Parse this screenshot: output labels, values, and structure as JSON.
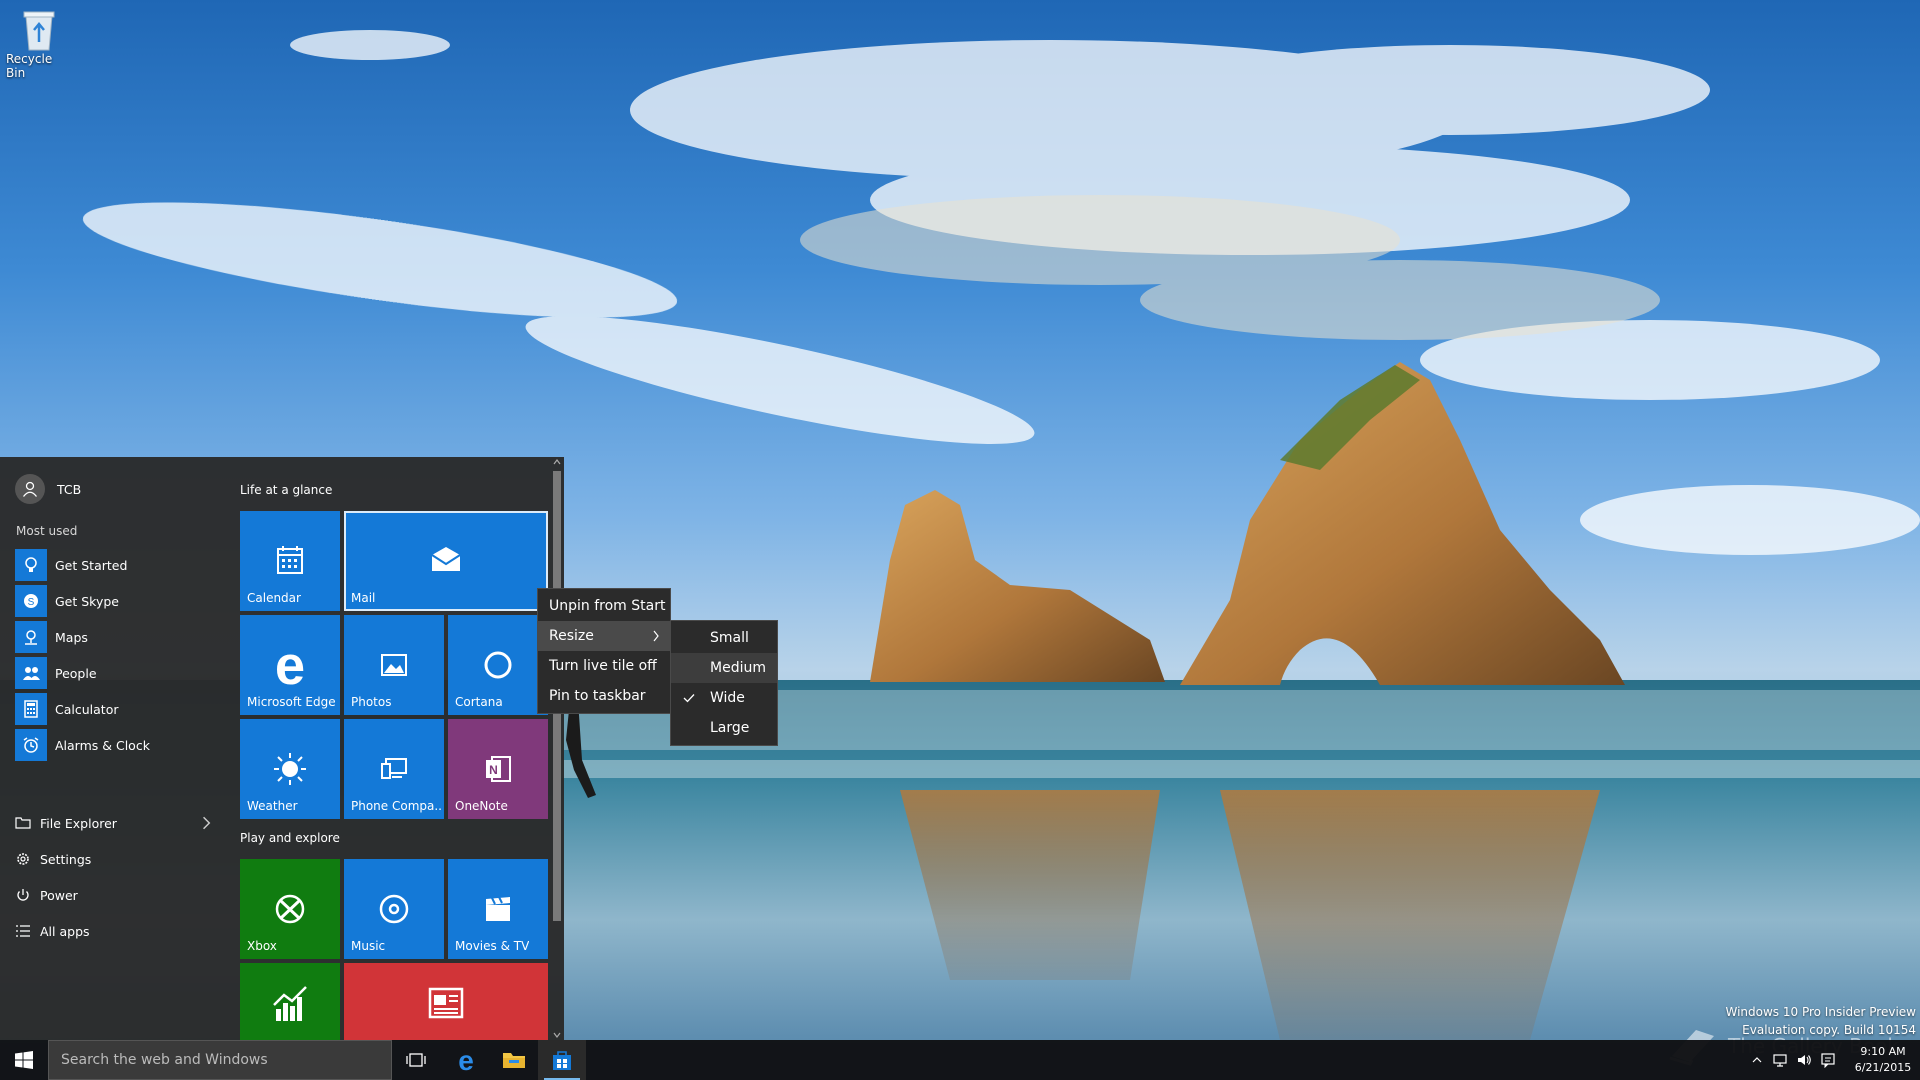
{
  "desktop": {
    "recycle_bin_label": "Recycle Bin"
  },
  "start_menu": {
    "user_name": "TCB",
    "most_used_label": "Most used",
    "most_used": [
      {
        "label": "Get Started",
        "icon": "lightbulb-icon"
      },
      {
        "label": "Get Skype",
        "icon": "skype-icon"
      },
      {
        "label": "Maps",
        "icon": "maps-icon"
      },
      {
        "label": "People",
        "icon": "people-icon"
      },
      {
        "label": "Calculator",
        "icon": "calculator-icon"
      },
      {
        "label": "Alarms & Clock",
        "icon": "alarm-clock-icon"
      }
    ],
    "bottom": [
      {
        "label": "File Explorer",
        "icon": "folder-icon"
      },
      {
        "label": "Settings",
        "icon": "gear-icon"
      },
      {
        "label": "Power",
        "icon": "power-icon"
      },
      {
        "label": "All apps",
        "icon": "list-icon"
      }
    ],
    "groups": [
      {
        "label": "Life at a glance"
      },
      {
        "label": "Play and explore"
      }
    ],
    "tiles": {
      "calendar": "Calendar",
      "mail": "Mail",
      "edge": "Microsoft Edge",
      "photos": "Photos",
      "cortana": "Cortana",
      "weather": "Weather",
      "phone": "Phone Compa...",
      "onenote": "OneNote",
      "xbox": "Xbox",
      "music": "Music",
      "movies": "Movies & TV"
    },
    "tile_colors": {
      "blue": "#1479d7",
      "onenote": "#80397b",
      "xbox": "#107c10",
      "news": "#d13438"
    }
  },
  "context_menu": {
    "items": [
      {
        "label": "Unpin from Start"
      },
      {
        "label": "Resize"
      },
      {
        "label": "Turn live tile off"
      },
      {
        "label": "Pin to taskbar"
      }
    ]
  },
  "resize_menu": {
    "items": [
      {
        "label": "Small"
      },
      {
        "label": "Medium"
      },
      {
        "label": "Wide",
        "checked": true
      },
      {
        "label": "Large"
      }
    ]
  },
  "taskbar": {
    "search_placeholder": "Search the web and Windows",
    "clock_time": "9:10 AM",
    "clock_date": "6/21/2015"
  },
  "watermark": {
    "line1": "Windows 10 Pro Insider Preview",
    "line2": "Evaluation copy. Build 10154",
    "logo_text": "The Gallery Book"
  }
}
